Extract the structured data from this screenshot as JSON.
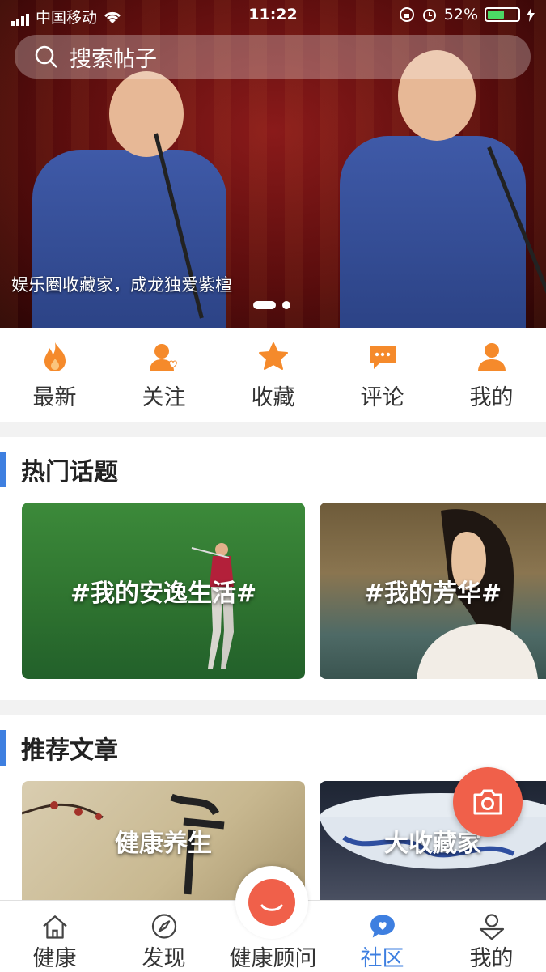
{
  "status_bar": {
    "carrier": "中国移动",
    "time": "11:22",
    "battery": "52%"
  },
  "search": {
    "placeholder": "搜索帖子"
  },
  "banner": {
    "caption": "娱乐圈收藏家，成龙独爱紫檀",
    "page_count": 2,
    "active_page": 1
  },
  "quick_nav": [
    {
      "label": "最新",
      "icon": "fire-icon"
    },
    {
      "label": "关注",
      "icon": "follow-icon"
    },
    {
      "label": "收藏",
      "icon": "star-icon"
    },
    {
      "label": "评论",
      "icon": "comment-icon"
    },
    {
      "label": "我的",
      "icon": "user-icon"
    }
  ],
  "hot_topics": {
    "title": "热门话题",
    "items": [
      {
        "label": "#我的安逸生活#"
      },
      {
        "label": "#我的芳华#"
      }
    ]
  },
  "articles": {
    "title": "推荐文章",
    "items": [
      {
        "label": "健康养生"
      },
      {
        "label": "大收藏家"
      }
    ]
  },
  "tab_bar": [
    {
      "label": "健康",
      "icon": "home-icon"
    },
    {
      "label": "发现",
      "icon": "compass-icon"
    },
    {
      "label": "健康顾问",
      "icon": "advisor-icon"
    },
    {
      "label": "社区",
      "icon": "community-icon",
      "active": true
    },
    {
      "label": "我的",
      "icon": "profile-icon"
    }
  ],
  "colors": {
    "accent": "#3e7fe0",
    "orange": "#f58a2b",
    "red": "#f0604a"
  }
}
